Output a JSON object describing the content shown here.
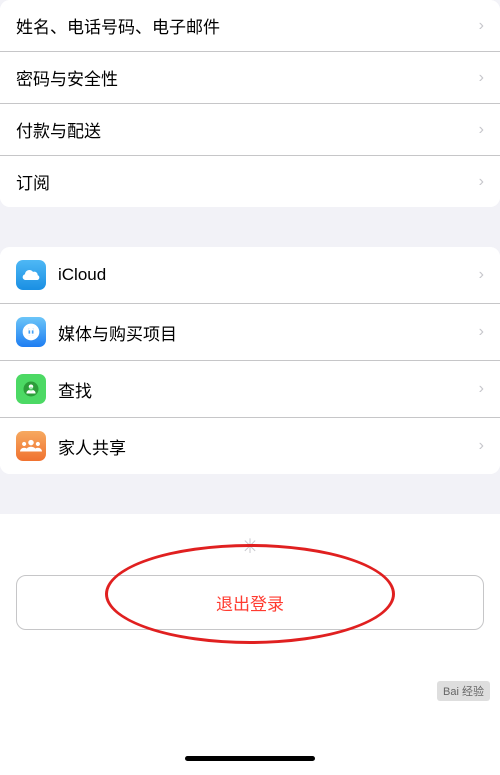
{
  "sections": {
    "group1": {
      "items": [
        {
          "id": "name-phone-email",
          "label": "姓名、电话号码、电子邮件",
          "hasIcon": false
        },
        {
          "id": "password-security",
          "label": "密码与安全性",
          "hasIcon": false
        },
        {
          "id": "payment-delivery",
          "label": "付款与配送",
          "hasIcon": false
        },
        {
          "id": "subscription",
          "label": "订阅",
          "hasIcon": false
        }
      ]
    },
    "group2": {
      "items": [
        {
          "id": "icloud",
          "label": "iCloud",
          "hasIcon": true,
          "iconType": "icloud"
        },
        {
          "id": "media-purchases",
          "label": "媒体与购买项目",
          "hasIcon": true,
          "iconType": "appstore"
        },
        {
          "id": "find",
          "label": "查找",
          "hasIcon": true,
          "iconType": "find"
        },
        {
          "id": "family-sharing",
          "label": "家人共享",
          "hasIcon": true,
          "iconType": "family"
        }
      ]
    },
    "signOut": {
      "label": "退出登录"
    }
  },
  "watermark": "Bai 经验",
  "homeBar": true
}
